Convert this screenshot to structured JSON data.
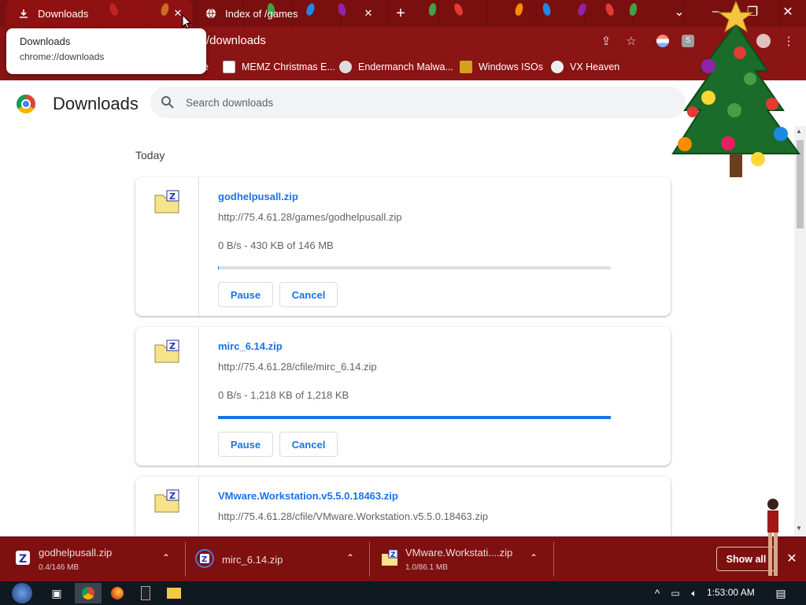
{
  "tabs": [
    {
      "title": "Downloads",
      "icon": "download-icon",
      "active": true
    },
    {
      "title": "Index of /games",
      "icon": "globe-icon",
      "active": false
    }
  ],
  "tooltip": {
    "title": "Downloads",
    "url": "chrome://downloads"
  },
  "toolbar": {
    "url_visible": "/downloads"
  },
  "bookmarks": [
    {
      "label": "MEMZ Christmas E...",
      "icon": "page-icon"
    },
    {
      "label": "Endermanch Malwa...",
      "icon": "skull-icon"
    },
    {
      "label": "Windows ISOs",
      "icon": "figure-icon"
    },
    {
      "label": "VX Heaven",
      "icon": "biohazard-icon"
    }
  ],
  "bookmarks_partial": "e",
  "page": {
    "title": "Downloads",
    "search_placeholder": "Search downloads",
    "section": "Today"
  },
  "downloads": [
    {
      "name": "godhelpusall.zip",
      "url": "http://75.4.61.28/games/godhelpusall.zip",
      "status": "0 B/s - 430 KB of 146 MB",
      "progress": 0.003,
      "pause_label": "Pause",
      "cancel_label": "Cancel"
    },
    {
      "name": "mirc_6.14.zip",
      "url": "http://75.4.61.28/cfile/mirc_6.14.zip",
      "status": "0 B/s - 1,218 KB of 1,218 KB",
      "progress": 1.0,
      "pause_label": "Pause",
      "cancel_label": "Cancel"
    },
    {
      "name": "VMware.Workstation.v5.5.0.18463.zip",
      "url": "http://75.4.61.28/cfile/VMware.Workstation.v5.5.0.18463.zip"
    }
  ],
  "shelf": {
    "items": [
      {
        "name": "godhelpusall.zip",
        "size": "0.4/146 MB"
      },
      {
        "name": "mirc_6.14.zip",
        "size": ""
      },
      {
        "name": "VMware.Workstati....zip",
        "size": "1.0/86.1 MB"
      }
    ],
    "show_all": "Show all"
  },
  "taskbar": {
    "clock": "1:53:00 AM"
  },
  "colors": {
    "tabstrip": "#7a0f0f",
    "toolbar": "#8b1414",
    "accent": "#1a73e8",
    "shelf": "#7f1010",
    "taskbar": "#101820"
  }
}
